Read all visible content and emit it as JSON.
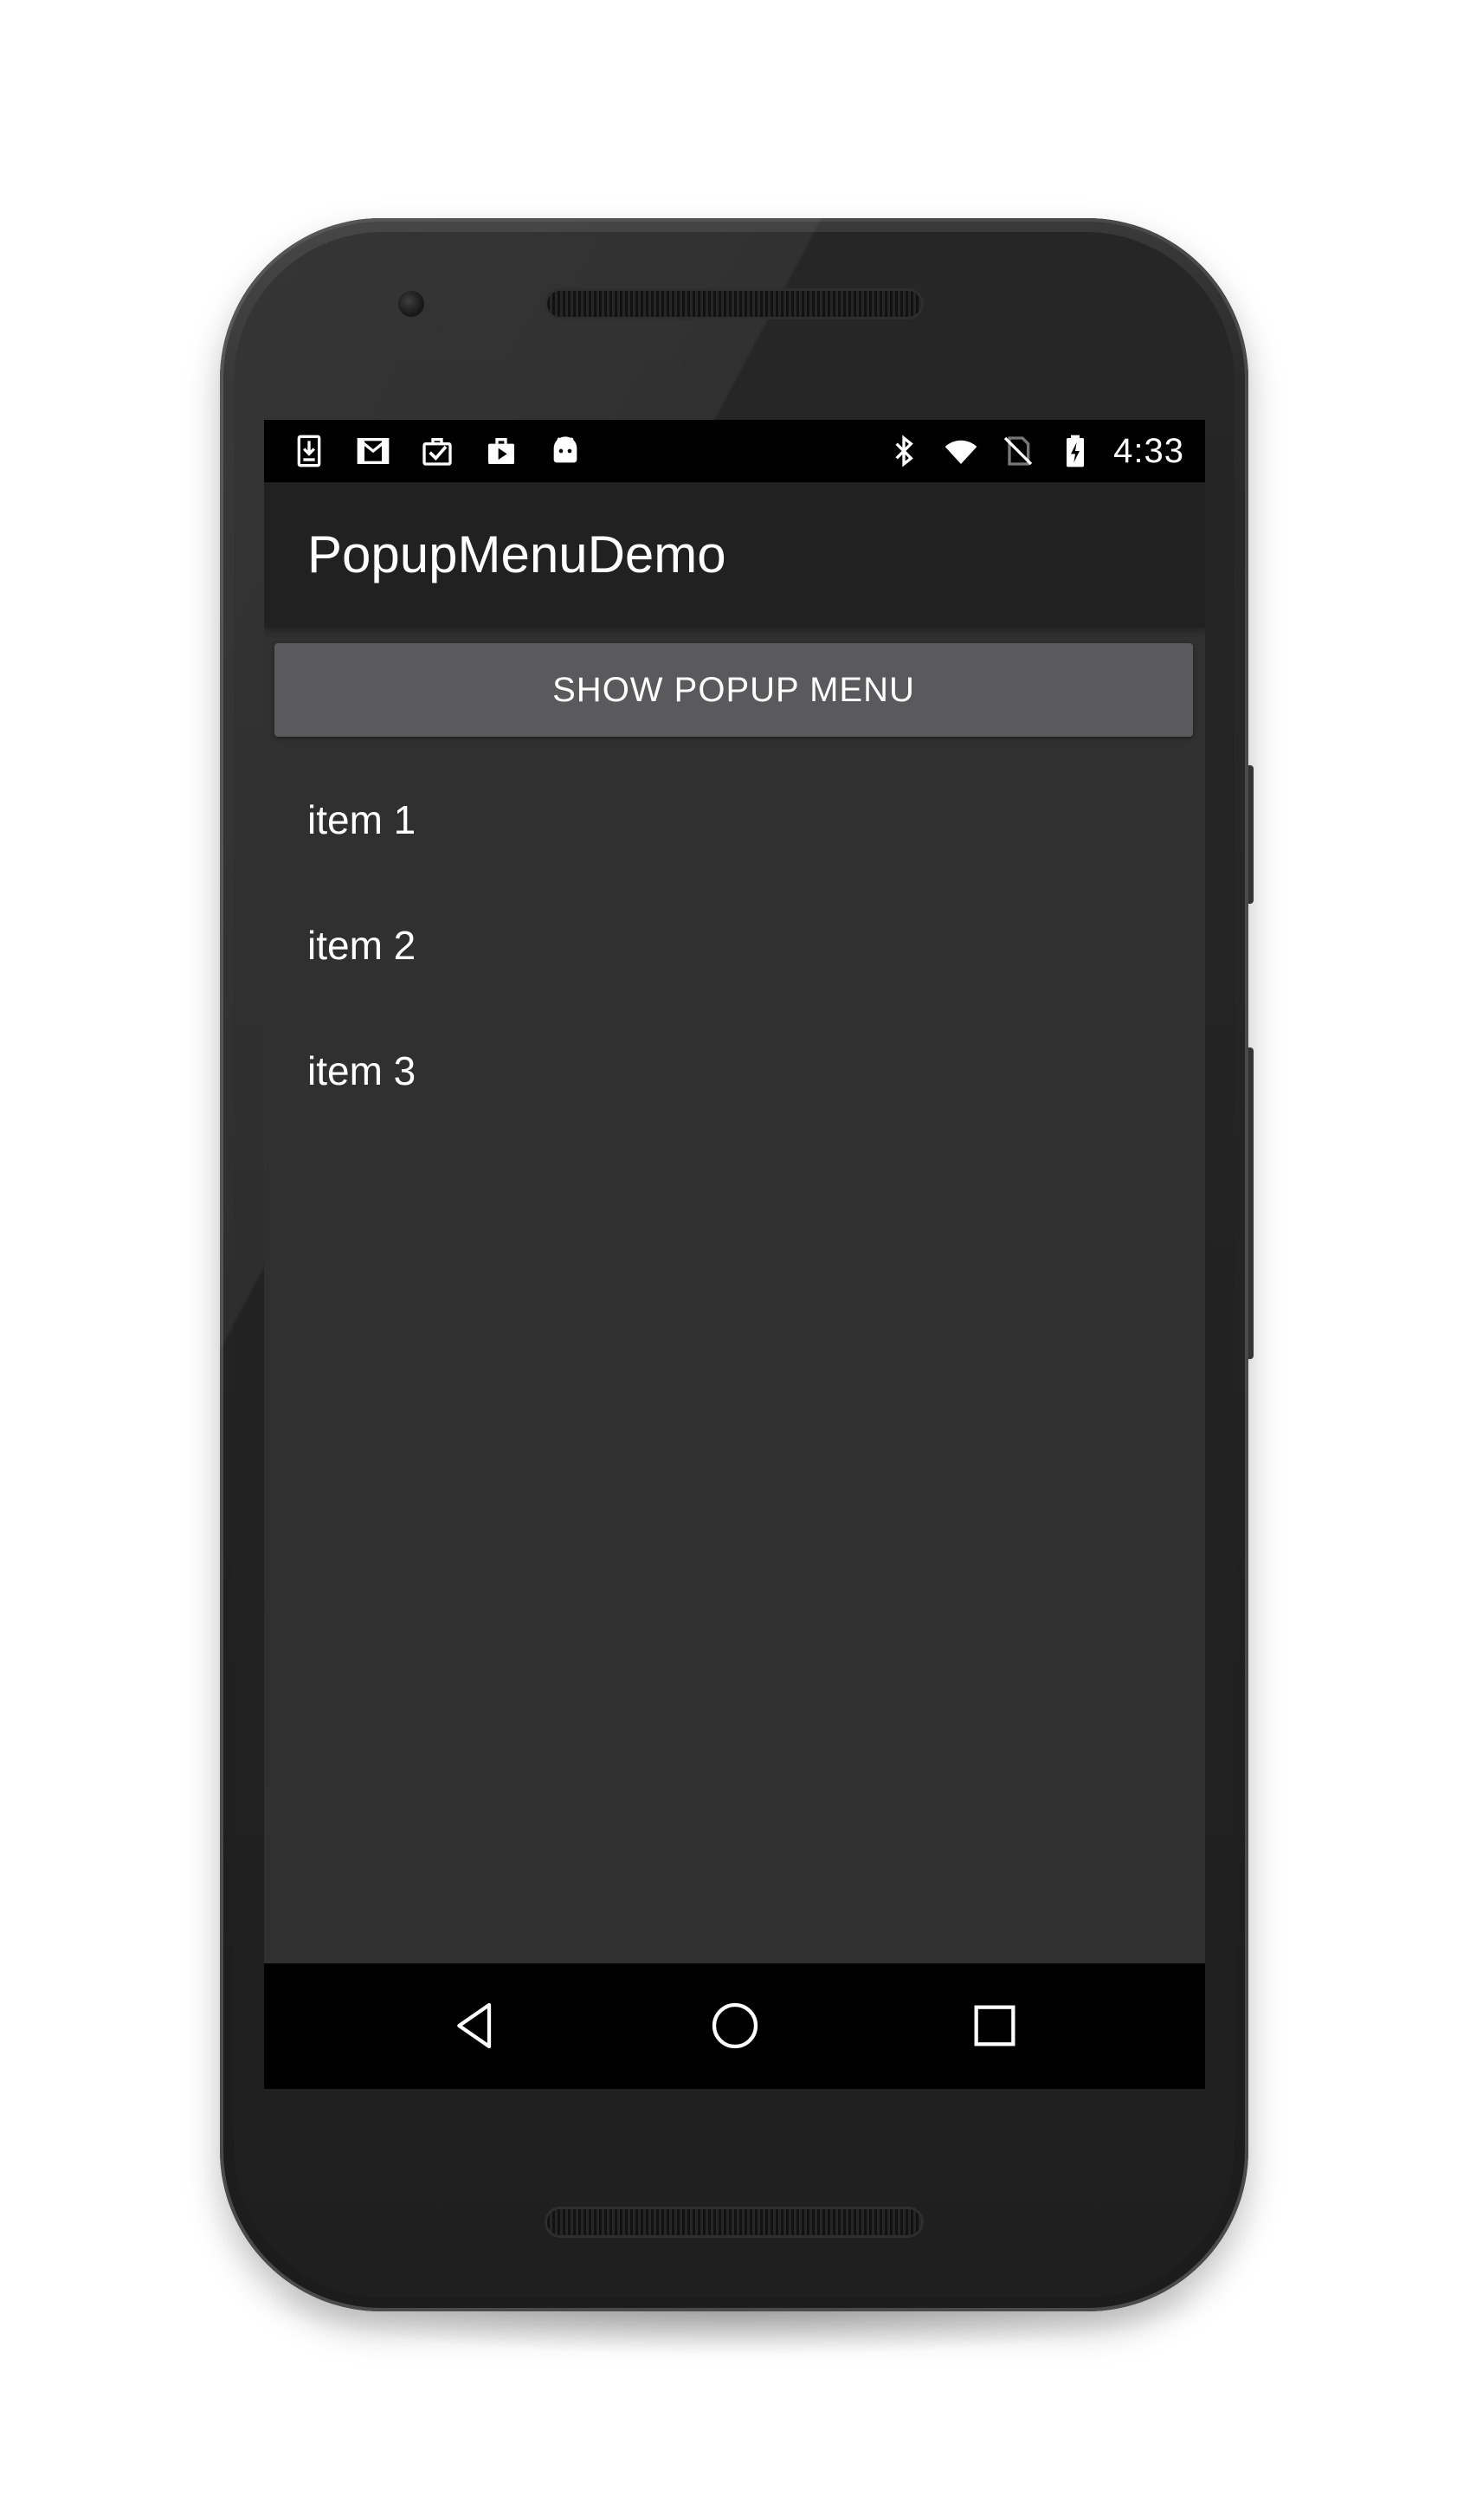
{
  "status_bar": {
    "time": "4:33",
    "left_icons": [
      "download-icon",
      "gmail-icon",
      "clipboard-check-icon",
      "play-store-icon",
      "android-icon"
    ],
    "right_icons": [
      "bluetooth-icon",
      "wifi-icon",
      "no-sim-icon",
      "battery-charging-icon"
    ]
  },
  "app_bar": {
    "title": "PopupMenuDemo"
  },
  "main": {
    "show_popup_button_label": "SHOW POPUP MENU",
    "items": [
      {
        "label": "item 1"
      },
      {
        "label": "item 2"
      },
      {
        "label": "item 3"
      }
    ]
  },
  "nav_bar": {
    "buttons": [
      "back-icon",
      "home-icon",
      "recents-icon"
    ]
  },
  "colors": {
    "screen_background": "#303030",
    "app_bar": "#212121",
    "button": "#5a5a5c",
    "status_bar": "#000000",
    "text": "#ffffff"
  }
}
